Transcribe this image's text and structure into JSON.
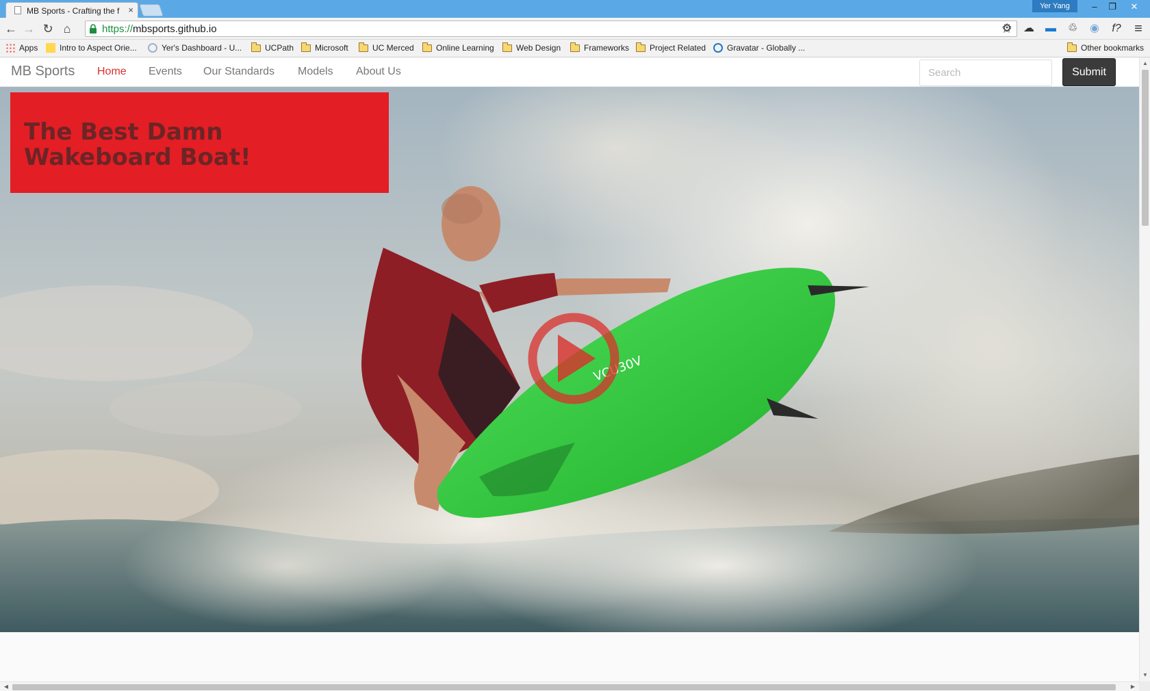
{
  "browser": {
    "tab": {
      "title": "MB Sports - Crafting the f",
      "close": "×"
    },
    "user": "Yer Yang",
    "window": {
      "minimize": "–",
      "maximize": "❐",
      "close": "✕"
    },
    "url": {
      "scheme": "https://",
      "host": "mbsports.github.io"
    },
    "toolbar_icons": {
      "back": "←",
      "forward": "→",
      "reload": "↻",
      "home": "⌂",
      "star": "☆",
      "menu": "≡"
    },
    "extensions": [
      "⚙",
      "☁",
      "▬",
      "♲",
      "◉",
      "f?"
    ],
    "bookmarks": [
      {
        "label": "Apps",
        "icon": "apps-grid"
      },
      {
        "label": "Intro to Aspect Orie...",
        "icon": "yellow-square"
      },
      {
        "label": "Yer's Dashboard - U...",
        "icon": "gear"
      },
      {
        "label": "UCPath",
        "icon": "folder"
      },
      {
        "label": "Microsoft",
        "icon": "folder"
      },
      {
        "label": "UC Merced",
        "icon": "folder"
      },
      {
        "label": "Online Learning",
        "icon": "folder"
      },
      {
        "label": "Web Design",
        "icon": "folder"
      },
      {
        "label": "Frameworks",
        "icon": "folder"
      },
      {
        "label": "Project Related",
        "icon": "folder"
      },
      {
        "label": "Gravatar - Globally ...",
        "icon": "gravatar"
      }
    ],
    "other_bookmarks": "Other bookmarks"
  },
  "site": {
    "brand": "MB Sports",
    "nav": [
      {
        "label": "Home",
        "active": true
      },
      {
        "label": "Events",
        "active": false
      },
      {
        "label": "Our Standards",
        "active": false
      },
      {
        "label": "Models",
        "active": false
      },
      {
        "label": "About Us",
        "active": false
      }
    ],
    "search": {
      "placeholder": "Search",
      "value": ""
    },
    "submit_label": "Submit",
    "hero": {
      "headline": "The Best Damn Wakeboard Boat!",
      "board_text": "VCU30V",
      "board_color": "#2fc53a",
      "play_color": "#d9302c",
      "headline_bg": "#e31e24"
    }
  }
}
